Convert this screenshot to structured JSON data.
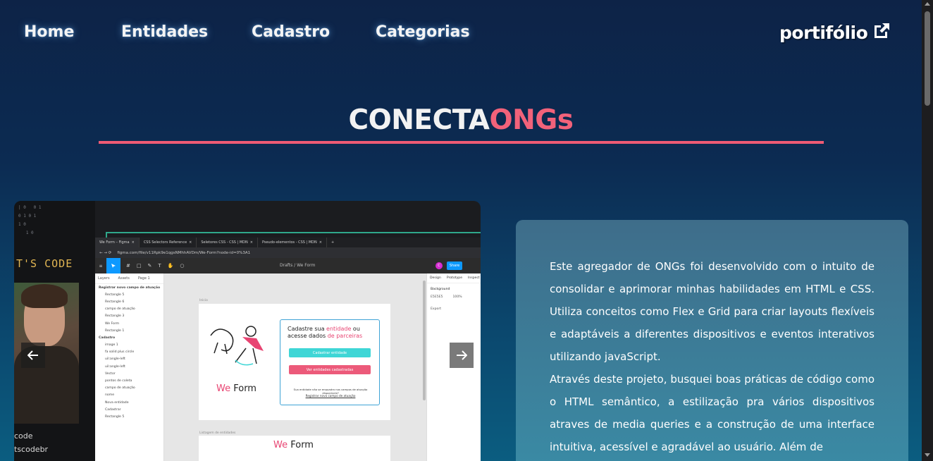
{
  "nav": {
    "links": [
      "Home",
      "Entidades",
      "Cadastro",
      "Categorias"
    ],
    "portfolio_label": "portifólio",
    "portfolio_icon": "external-link-icon"
  },
  "title": {
    "part1": "CONECTA",
    "part2": "ONGs",
    "part2_color": "#f2627a",
    "underline_color": "#ef5a74"
  },
  "carousel": {
    "prev_icon": "arrow-left-icon",
    "next_icon": "arrow-right-icon",
    "slide": {
      "video_banner": "T'S CODE",
      "video_caption_1": "code",
      "video_caption_2": "tscodebr",
      "tabs": [
        "We Form – Figma",
        "CSS Selectors Reference",
        "Seletores CSS - CSS | MDN",
        "Pseudo-elementos - CSS | MDN"
      ],
      "url": "figma.com/file/v11Rpk9e1qgsNMhhAVDm/We-Form?node-id=0%3A1",
      "breadcrumb": "Drafts / We Form",
      "share_label": "Share",
      "avatar_letter": "C",
      "layers_tabs": [
        "Layers",
        "Assets",
        "Page 1"
      ],
      "layers": [
        {
          "label": "Registrar novo campo de atuação",
          "group": true
        },
        {
          "label": "Rectangle 5",
          "group": false
        },
        {
          "label": "Rectangle 6",
          "group": false
        },
        {
          "label": "campo de atuação",
          "group": false
        },
        {
          "label": "Rectangle 3",
          "group": false
        },
        {
          "label": "We Form",
          "group": false
        },
        {
          "label": "Rectangle 1",
          "group": false
        },
        {
          "label": "Cadastro",
          "group": true
        },
        {
          "label": "image 1",
          "group": false
        },
        {
          "label": "fa solid plus circle",
          "group": false
        },
        {
          "label": "uil:angle-left",
          "group": false
        },
        {
          "label": "uil:angle-left",
          "group": false
        },
        {
          "label": "Vector",
          "group": false
        },
        {
          "label": "pontos de coleta",
          "group": false
        },
        {
          "label": "campo de atuação",
          "group": false
        },
        {
          "label": "nome",
          "group": false
        },
        {
          "label": "Nova entidade",
          "group": false
        },
        {
          "label": "Cadastrar",
          "group": false
        },
        {
          "label": "Rectangle 5",
          "group": false
        }
      ],
      "frame_label_1": "Inicio",
      "frame_label_2": "Listagem de entidades",
      "card_title_a": "Cadastre sua ",
      "card_title_b": "entidade",
      "card_title_c": " ou acesse dados ",
      "card_title_d": "de parceiras",
      "btn_cadastrar": "Cadastrar entidade",
      "btn_ver": "Ver entidades cadastradas",
      "small_text": "Sua entidade não se enquadra nos campos de atuação disponíveis?",
      "link_text": "Registrar novo campo de atuação",
      "weform_we": "We",
      "weform_form": " Form",
      "design_tabs": [
        "Design",
        "Prototype",
        "Inspect"
      ],
      "design_background": "Background",
      "design_color": "E5E5E5",
      "design_opacity": "100%",
      "design_export": "Export"
    }
  },
  "description": {
    "paragraph1": "Este agregador de ONGs foi desenvolvido com o intuito de consolidar e aprimorar minhas habilidades em HTML e CSS. Utiliza conceitos como Flex e Grid para criar layouts flexíveis e adaptáveis a diferentes dispositivos e eventos interativos utilizando javaScript.",
    "paragraph2": "Através deste projeto, busquei boas práticas de código como o HTML semântico, a estilização pra vários dispositivos atraves de media queries e a construção de uma interface intuitiva, acessível e agradável ao usuário. Além de"
  },
  "colors": {
    "background_top": "#0d2347",
    "background_bottom": "#0b5d80",
    "card": "#3c7f9a"
  }
}
